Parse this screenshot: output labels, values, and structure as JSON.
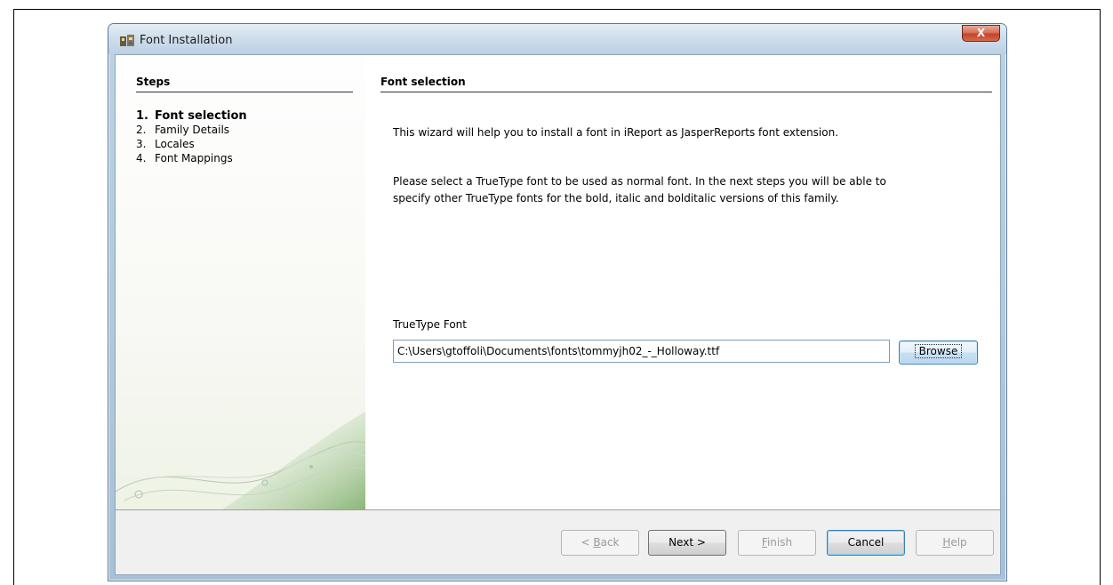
{
  "window": {
    "title": "Font Installation",
    "close_glyph": "X"
  },
  "steps": {
    "title": "Steps",
    "items": [
      {
        "num": "1.",
        "label": "Font selection",
        "active": true
      },
      {
        "num": "2.",
        "label": "Family Details",
        "active": false
      },
      {
        "num": "3.",
        "label": "Locales",
        "active": false
      },
      {
        "num": "4.",
        "label": "Font Mappings",
        "active": false
      }
    ]
  },
  "content": {
    "title": "Font selection",
    "intro": "This wizard will help you to install a font in iReport as JasperReports font extension.",
    "desc_line1": "Please select a TrueType font to be used as normal font. In the next steps you will be able to",
    "desc_line2": "specify other TrueType fonts for the bold, italic and bolditalic versions of this family.",
    "truetype_label": "TrueType Font",
    "truetype_value": "C:\\Users\\gtoffoli\\Documents\\fonts\\tommyjh02_-_Holloway.ttf",
    "browse_label": "Browse"
  },
  "buttons": {
    "back_prefix": "< ",
    "back_mnemonic": "B",
    "back_rest": "ack",
    "next_label": "Next >",
    "finish_mnemonic": "F",
    "finish_rest": "inish",
    "cancel_label": "Cancel",
    "help_mnemonic": "H",
    "help_rest": "elp"
  }
}
